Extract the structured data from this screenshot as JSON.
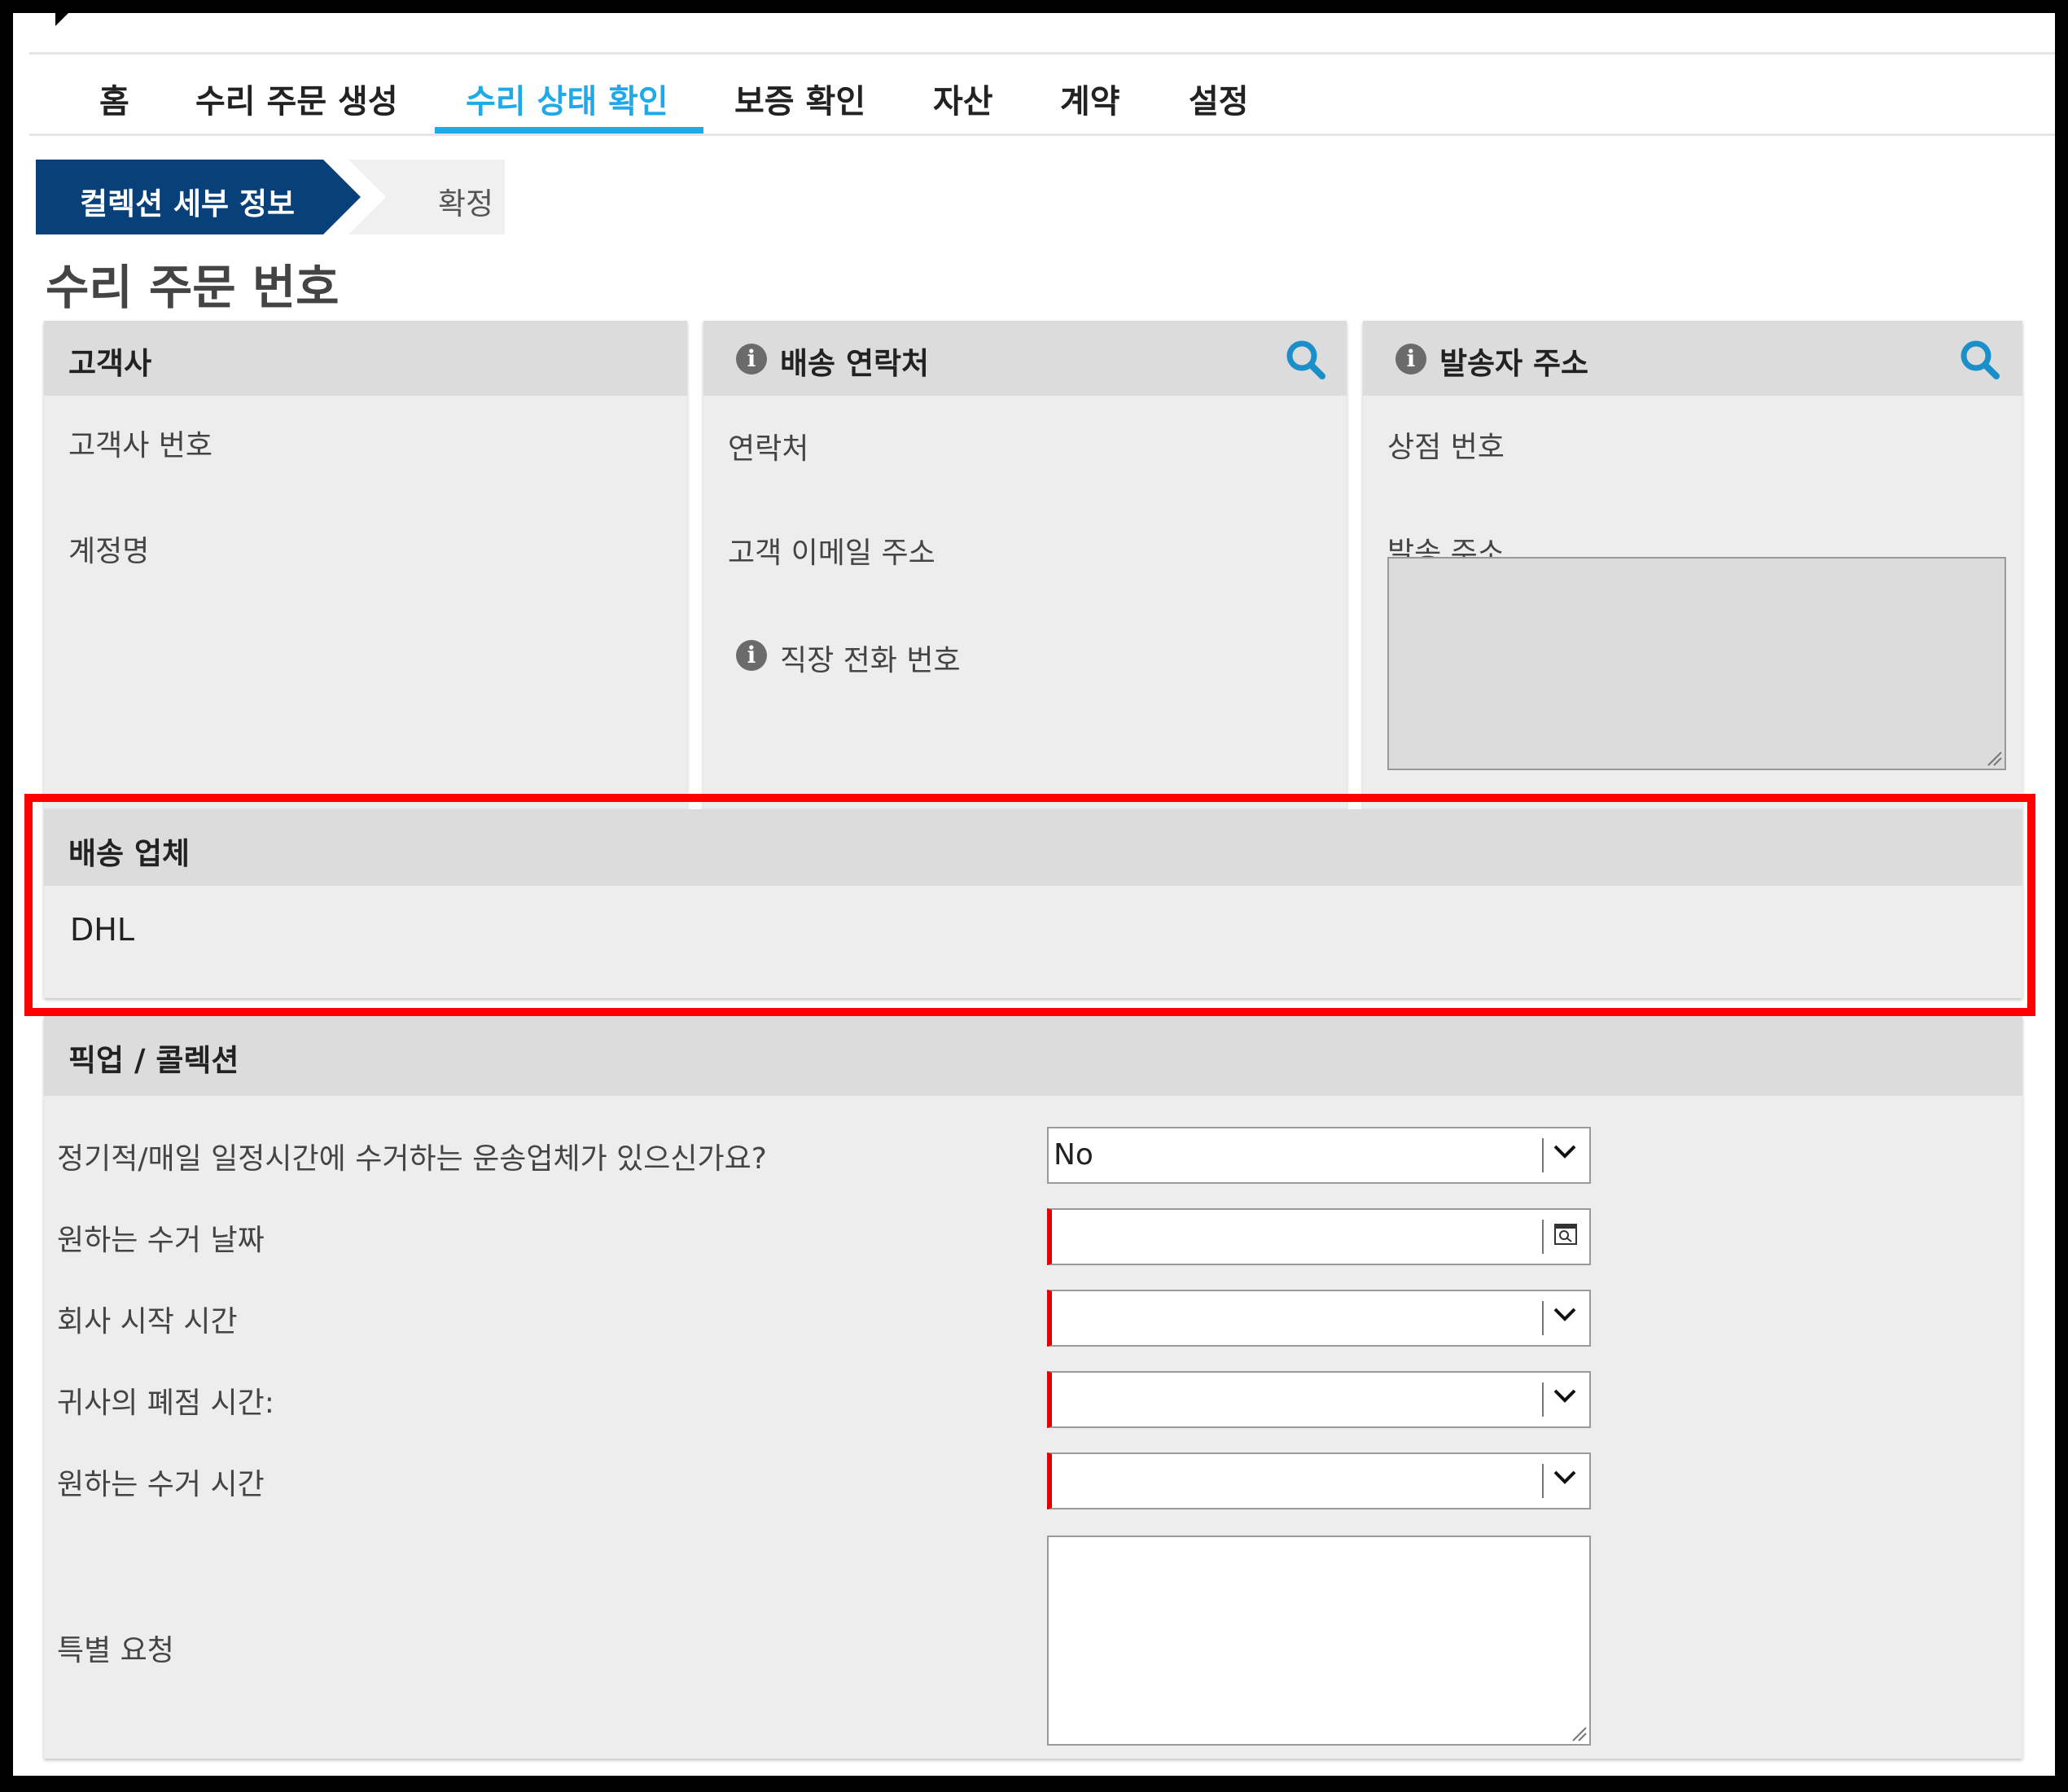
{
  "nav": {
    "items": [
      {
        "label": "홈"
      },
      {
        "label": "수리 주문 생성"
      },
      {
        "label": "수리 상태 확인"
      },
      {
        "label": "보증 확인"
      },
      {
        "label": "자산"
      },
      {
        "label": "계약"
      },
      {
        "label": "설정"
      }
    ],
    "active": "수리 상태 확인"
  },
  "breadcrumb": {
    "current": "컬렉션 세부 정보",
    "next": "확정"
  },
  "page_title": "수리 주문 번호",
  "customer_card": {
    "title": "고객사",
    "fields": [
      "고객사 번호",
      "계정명"
    ]
  },
  "shipping_contact_card": {
    "title": "배송 연락처",
    "fields": [
      "연락처",
      "고객 이메일 주소",
      "직장 전화 번호"
    ]
  },
  "sender_address_card": {
    "title": "발송자 주소",
    "fields": [
      "상점 번호",
      "발송 주소"
    ]
  },
  "carrier_card": {
    "title": "배송 업체",
    "value": "DHL"
  },
  "pickup_card": {
    "title": "픽업 / 콜렉션",
    "regular_pickup_label": "정기적/매일 일정시간에 수거하는 운송업체가 있으신가요?",
    "regular_pickup_value": "No",
    "pickup_date_label": "원하는 수거 날짜",
    "company_start_label": "회사 시작 시간",
    "company_close_label": "귀사의 폐점 시간:",
    "pickup_time_label": "원하는 수거 시간",
    "special_request_label": "특별 요청"
  },
  "colors": {
    "accent": "#1fa9e8",
    "breadcrumb_active": "#08407a",
    "search_icon": "#1a8fc9",
    "highlight": "#ff0000",
    "required_marker": "#e00000"
  }
}
